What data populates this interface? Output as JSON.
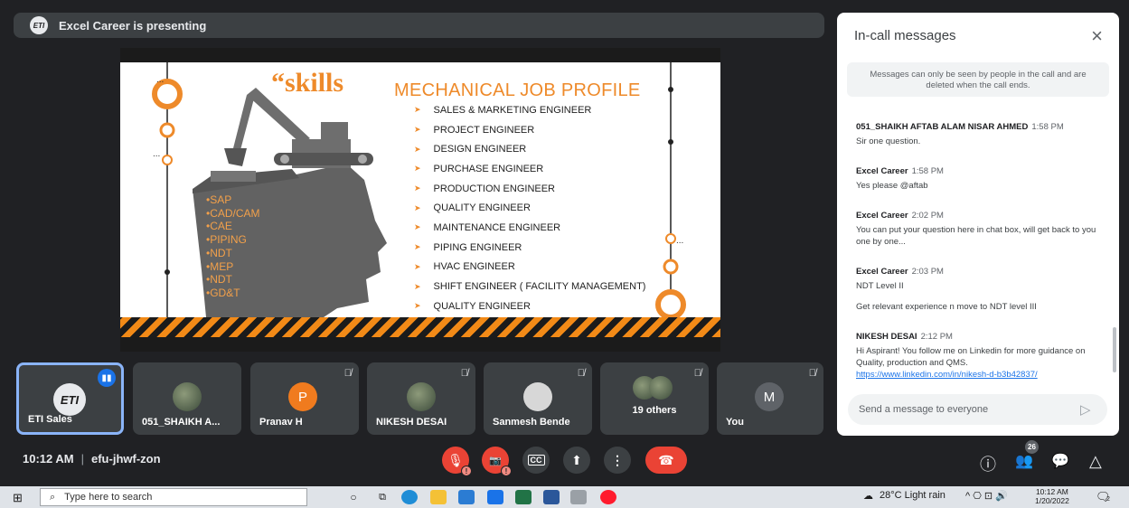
{
  "presenting": {
    "logo_text": "ETI",
    "label": "Excel Career is presenting"
  },
  "slide": {
    "quote_word": "“skills",
    "title": "MECHANICAL JOB PROFILE",
    "arrow_glyph": "➤",
    "jobs": [
      "SALES & MARKETING ENGINEER",
      "PROJECT ENGINEER",
      "DESIGN ENGINEER",
      "PURCHASE ENGINEER",
      "PRODUCTION ENGINEER",
      "QUALITY ENGINEER",
      "MAINTENANCE ENGINEER",
      "PIPING ENGINEER",
      "HVAC ENGINEER",
      "SHIFT ENGINEER ( FACILITY MANAGEMENT)",
      "QUALITY ENGINEER"
    ],
    "skills": [
      "•SAP",
      "•CAD/CAM",
      "•CAE",
      "•PIPING",
      "•NDT",
      "•MEP",
      "•NDT",
      "•GD&T"
    ],
    "accent_color": "#ee8a2a"
  },
  "tiles": [
    {
      "name": "ETI Sales",
      "avatar_text": "ETI",
      "speaking": true
    },
    {
      "name": "051_SHAIKH A..."
    },
    {
      "name": "Pranav H",
      "avatar_text": "P",
      "muted": true
    },
    {
      "name": "NIKESH DESAI",
      "muted": true
    },
    {
      "name": "Sanmesh Bende",
      "muted": true
    },
    {
      "name": "19 others",
      "muted": true
    },
    {
      "name": "You",
      "avatar_text": "M",
      "muted": true
    }
  ],
  "chat": {
    "title": "In-call messages",
    "close_icon": "×",
    "notice": "Messages can only be seen by people in the call and are deleted when the call ends.",
    "messages": [
      {
        "sender": "051_SHAIKH AFTAB ALAM NISAR AHMED",
        "time": "1:58 PM",
        "lines": [
          "Sir one question."
        ]
      },
      {
        "sender": "Excel Career",
        "time": "1:58 PM",
        "lines": [
          "Yes please @aftab"
        ]
      },
      {
        "sender": "Excel Career",
        "time": "2:02 PM",
        "lines": [
          "You can put your question here in chat box, will get back to you one by one..."
        ]
      },
      {
        "sender": "Excel Career",
        "time": "2:03 PM",
        "lines": [
          "NDT Level II",
          "Get relevant experience n move to NDT level III"
        ]
      },
      {
        "sender": "NIKESH DESAI",
        "time": "2:12 PM",
        "lines": [
          "Hi Aspirant! You follow me on Linkedin for more guidance on Quality, production and QMS."
        ],
        "link": "https://www.linkedin.com/in/nikesh-d-b3b42837/"
      }
    ],
    "input_placeholder": "Send a message to everyone",
    "send_icon": "▷"
  },
  "bottom_bar": {
    "time": "10:12 AM",
    "separator": "|",
    "meeting_code": "efu-jhwf-zon",
    "people_count": "26",
    "mic_icon": "🎙",
    "cam_icon": "📷",
    "cc_label": "CC",
    "present_icon": "⬆",
    "more_icon": "⋮",
    "leave_icon": "☎",
    "warn_icon": "!",
    "info_icon": "ⓘ",
    "people_icon": "👥",
    "chat_icon": "💬",
    "activities_icon": "△"
  },
  "taskbar": {
    "windows_icon": "⊞",
    "search_icon": "⌕",
    "search_placeholder": "Type here to search",
    "weather": "28°C  Light rain",
    "tray_icons": "^  ⎔  ⊡  🔊",
    "clock_time": "10:12 AM",
    "clock_date": "1/20/2022",
    "notification_icon": "🗨",
    "notification_count": "2"
  }
}
